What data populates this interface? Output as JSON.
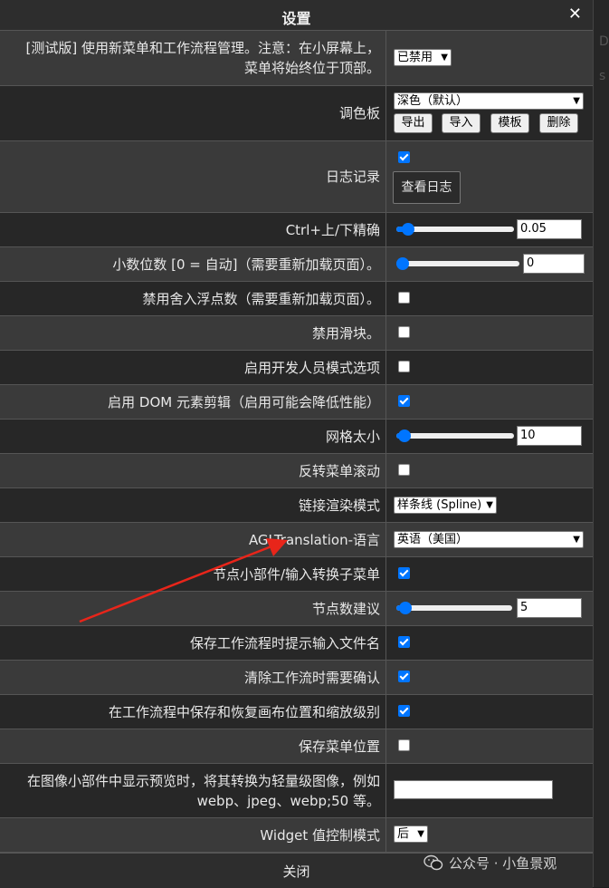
{
  "dialog": {
    "title": "设置",
    "close_icon": "✕",
    "close_label": "关闭"
  },
  "background": {
    "ghost_text": [
      "D",
      "s"
    ]
  },
  "rows": {
    "new_menu": {
      "label": "[测试版] 使用新菜单和工作流程管理。注意：在小屏幕上，菜单将始终位于顶部。",
      "value": "已禁用"
    },
    "palette": {
      "label": "调色板",
      "value": "深色（默认）",
      "buttons": [
        "导出",
        "导入",
        "模板",
        "删除"
      ]
    },
    "logging": {
      "label": "日志记录",
      "checked": true,
      "button": "查看日志"
    },
    "ctrl_updown": {
      "label": "Ctrl+上/下精确",
      "slider_fraction": 0.05,
      "value": "0.05"
    },
    "decimals": {
      "label": "小数位数 [0 = 自动]（需要重新加载页面）。",
      "slider_fraction": 0.0,
      "value": "0"
    },
    "disable_rounding": {
      "label": "禁用舍入浮点数（需要重新加载页面）。",
      "checked": false
    },
    "disable_slider": {
      "label": "禁用滑块。",
      "checked": false
    },
    "dev_mode": {
      "label": "启用开发人员模式选项",
      "checked": false
    },
    "dom_clipping": {
      "label": "启用 DOM 元素剪辑（启用可能会降低性能）",
      "checked": true
    },
    "grid_size": {
      "label": "网格太小",
      "slider_fraction": 0.02,
      "value": "10"
    },
    "invert_scroll": {
      "label": "反转菜单滚动",
      "checked": false
    },
    "link_render": {
      "label": "链接渲染模式",
      "value": "样条线 (Spline)"
    },
    "agl_lang": {
      "label": "AGLTranslation-语言",
      "value": "英语（美国）"
    },
    "widget_submenu": {
      "label": "节点小部件/输入转换子菜单",
      "checked": true
    },
    "node_suggest": {
      "label": "节点数建议",
      "slider_fraction": 0.03,
      "value": "5"
    },
    "prompt_filename": {
      "label": "保存工作流程时提示输入文件名",
      "checked": true
    },
    "confirm_clear": {
      "label": "清除工作流时需要确认",
      "checked": true
    },
    "save_canvas": {
      "label": "在工作流程中保存和恢复画布位置和缩放级别",
      "checked": true
    },
    "save_menu_pos": {
      "label": "保存菜单位置",
      "checked": false
    },
    "preview_format": {
      "label": "在图像小部件中显示预览时，将其转换为轻量级图像，例如 webp、jpeg、webp;50 等。",
      "value": ""
    },
    "widget_mode": {
      "label": "Widget 值控制模式",
      "value": "后"
    }
  },
  "watermark": {
    "text": "公众号 · 小鱼景观",
    "icon": "wechat-icon"
  },
  "colors": {
    "accent": "#0075ff",
    "annotation_arrow": "#e8251a"
  }
}
